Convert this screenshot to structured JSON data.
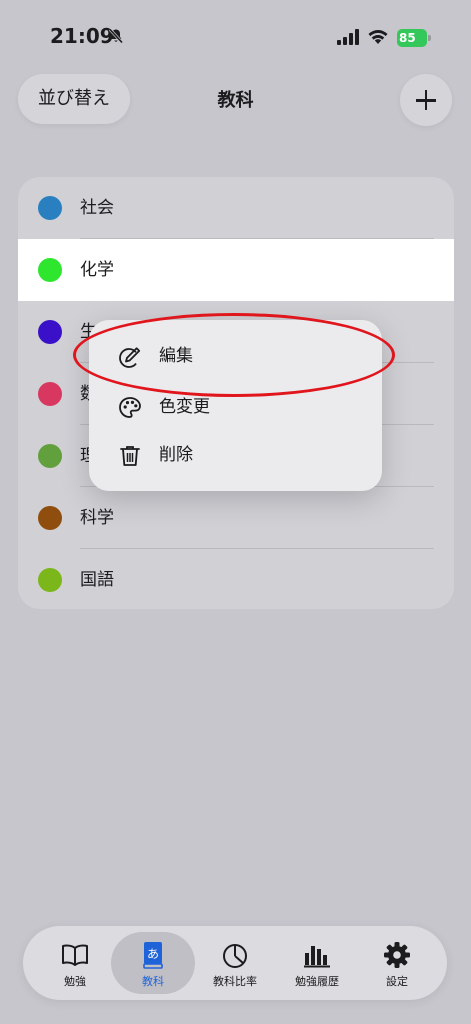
{
  "status": {
    "time": "21:09",
    "battery": "85"
  },
  "nav": {
    "sort_label": "並び替え",
    "title": "教科"
  },
  "subjects": [
    {
      "name": "社会",
      "color": "#2a7fc0"
    },
    {
      "name": "化学",
      "color": "#2ee62e"
    },
    {
      "name": "生物",
      "color": "#3a10c8"
    },
    {
      "name": "数学",
      "color": "#d8385f"
    },
    {
      "name": "理科",
      "color": "#62a03e"
    },
    {
      "name": "科学",
      "color": "#8f4e0e"
    },
    {
      "name": "国語",
      "color": "#7bb71a"
    }
  ],
  "menu": [
    {
      "label": "編集",
      "icon": "edit-icon"
    },
    {
      "label": "色変更",
      "icon": "palette-icon"
    },
    {
      "label": "削除",
      "icon": "trash-icon"
    }
  ],
  "tabs": [
    {
      "label": "勉強",
      "icon": "book-icon"
    },
    {
      "label": "教科",
      "icon": "subject-book-icon"
    },
    {
      "label": "教科比率",
      "icon": "pie-chart-icon"
    },
    {
      "label": "勉強履歴",
      "icon": "bar-chart-icon"
    },
    {
      "label": "設定",
      "icon": "gear-icon"
    }
  ],
  "colors": {
    "accent": "#1f63d9",
    "annotation": "#e0161c"
  }
}
